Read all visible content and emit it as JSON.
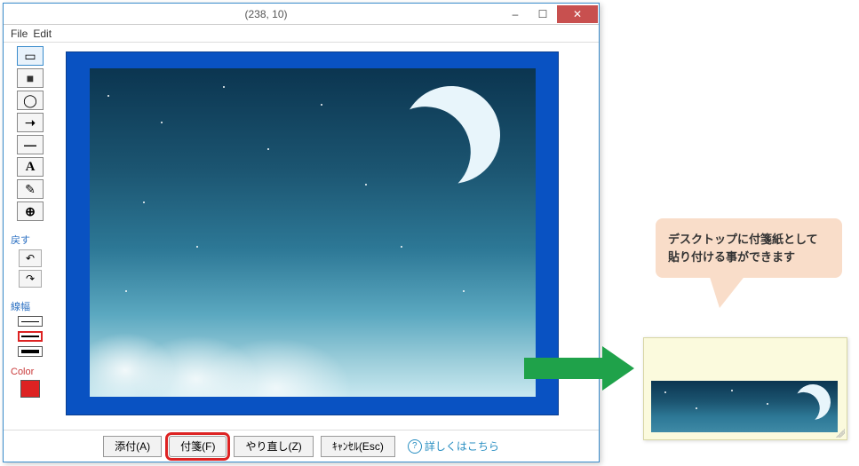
{
  "window": {
    "title": "(238, 10)"
  },
  "menubar": {
    "file": "File",
    "edit": "Edit"
  },
  "sidebar": {
    "undo_label": "戻す",
    "line_width_label": "線幅",
    "color_label": "Color",
    "selected_color": "#dd2222"
  },
  "tools": {
    "rect_outline": "▭",
    "rect_filled": "■",
    "ellipse": "◯",
    "arrow": "➝",
    "line": "―",
    "text": "A",
    "highlight": "✎",
    "zoom": "⊕"
  },
  "bottom_bar": {
    "attach": "添付(A)",
    "sticky": "付箋(F)",
    "redo": "やり直し(Z)",
    "cancel": "ｷｬﾝｾﾙ(Esc)",
    "help": "詳しくはこちら"
  },
  "callout": {
    "line1": "デスクトップに付箋紙として",
    "line2": "貼り付ける事ができます"
  }
}
